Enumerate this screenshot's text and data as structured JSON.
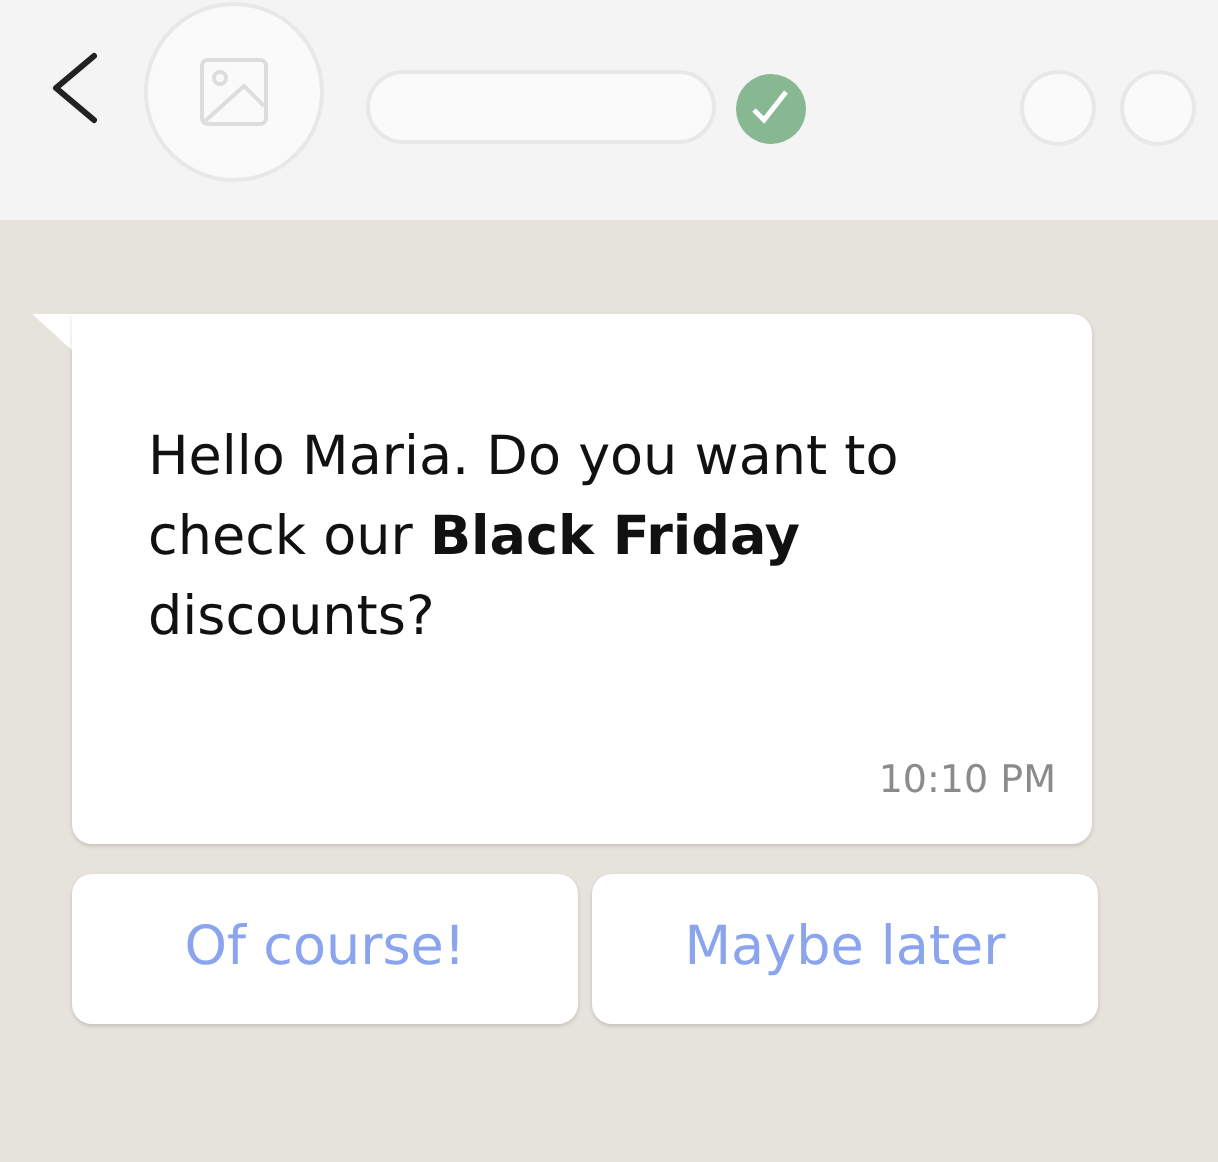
{
  "message": {
    "text": "Hello Maria. Do you want to check our **Black Friday** discounts?",
    "time": "10:10 PM"
  },
  "quick_replies": [
    {
      "label": "Of course!"
    },
    {
      "label": "Maybe later"
    }
  ]
}
